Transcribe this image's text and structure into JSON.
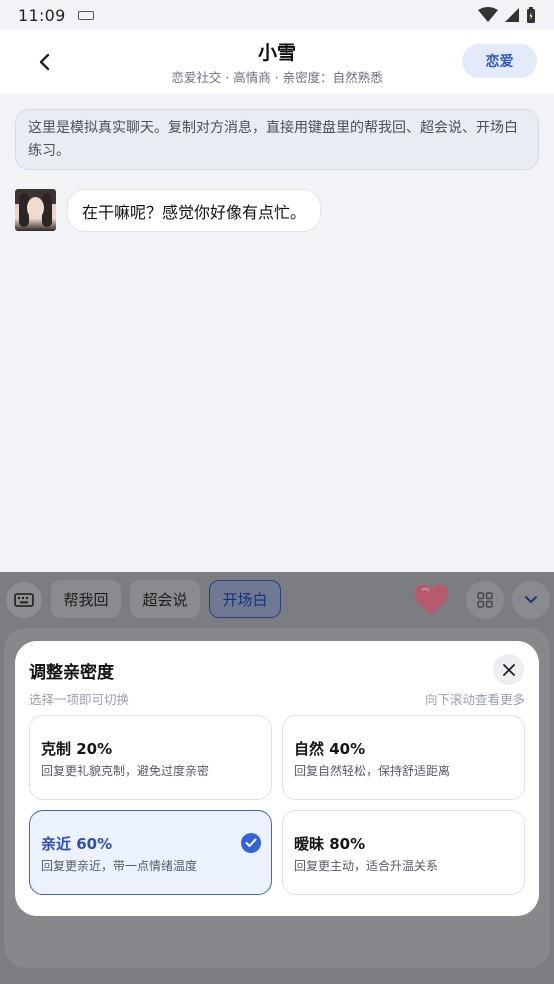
{
  "status_bar": {
    "time": "11:09"
  },
  "header": {
    "title": "小雪",
    "subtitle": "恋爱社交 · 高情商 · 亲密度：自然熟悉",
    "mode_label": "恋爱"
  },
  "chat": {
    "notice": "这里是模拟真实聊天。复制对方消息，直接用键盘里的帮我回、超会说、开场白练习。",
    "messages": [
      {
        "sender": "小雪",
        "text": "在干嘛呢？感觉你好像有点忙。"
      }
    ]
  },
  "keyboard": {
    "chips": [
      "帮我回",
      "超会说",
      "开场白"
    ],
    "active_chip": "开场白"
  },
  "sheet": {
    "title": "调整亲密度",
    "hint_left": "选择一项即可切换",
    "hint_right": "向下滚动查看更多",
    "options": [
      {
        "title": "克制 20%",
        "desc": "回复更礼貌克制，避免过度亲密",
        "selected": false
      },
      {
        "title": "自然 40%",
        "desc": "回复自然轻松，保持舒适距离",
        "selected": false
      },
      {
        "title": "亲近 60%",
        "desc": "回复更亲近，带一点情绪温度",
        "selected": true
      },
      {
        "title": "暧昧 80%",
        "desc": "回复更主动，适合升温关系",
        "selected": false
      }
    ]
  },
  "colors": {
    "accent": "#3462d9",
    "background": "#f2f3f7",
    "keyboard_bg": "#7c7d80",
    "heart": "#e8526d"
  }
}
